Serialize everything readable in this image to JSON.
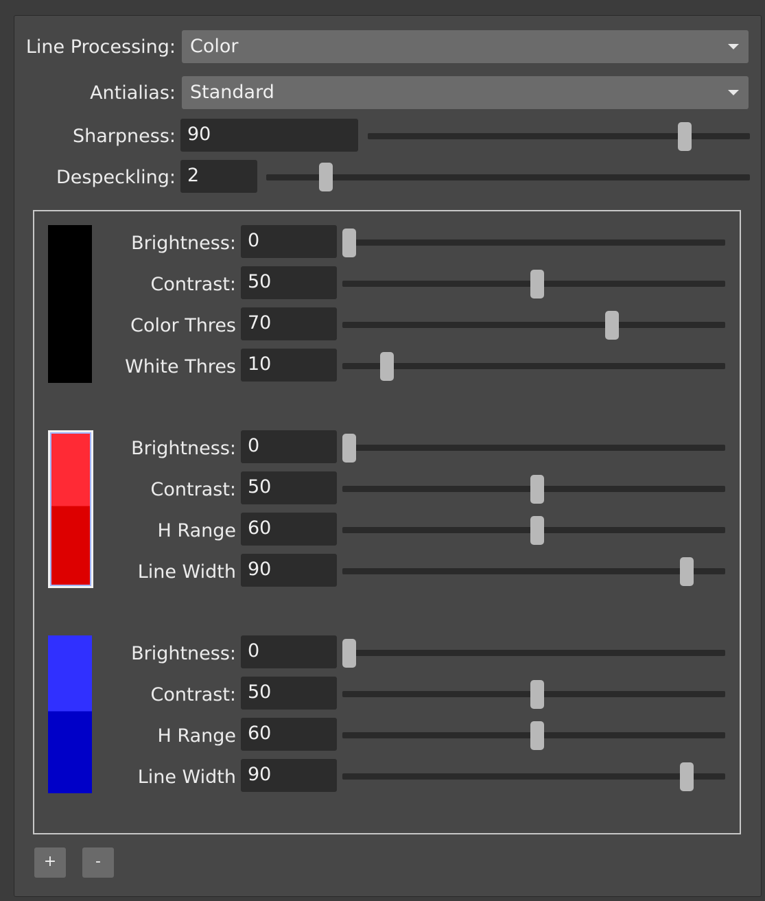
{
  "line_processing": {
    "label": "Line Processing:",
    "value": "Color"
  },
  "antialias": {
    "label": "Antialias:",
    "value": "Standard"
  },
  "sharpness": {
    "label": "Sharpness:",
    "value": "90",
    "level": 0.9
  },
  "despeckling": {
    "label": "Despeckling:",
    "value": "2",
    "level": 0.11
  },
  "groups": [
    {
      "colors": {
        "top": "#000000",
        "bottom": "#000000"
      },
      "rows": [
        {
          "label": "Brightness:",
          "value": "0",
          "level": 0.0
        },
        {
          "label": "Contrast:",
          "value": "50",
          "level": 0.5
        },
        {
          "label": "Color Thres",
          "value": "70",
          "level": 0.7
        },
        {
          "label": "White Thres",
          "value": "10",
          "level": 0.1
        }
      ]
    },
    {
      "colors": {
        "top": "#ff2a35",
        "bottom": "#dd0000"
      },
      "rows": [
        {
          "label": "Brightness:",
          "value": "0",
          "level": 0.0
        },
        {
          "label": "Contrast:",
          "value": "50",
          "level": 0.5
        },
        {
          "label": "H Range",
          "value": "60",
          "level": 0.5
        },
        {
          "label": "Line Width",
          "value": "90",
          "level": 0.9
        }
      ]
    },
    {
      "colors": {
        "top": "#3030ff",
        "bottom": "#0000c8"
      },
      "rows": [
        {
          "label": "Brightness:",
          "value": "0",
          "level": 0.0
        },
        {
          "label": "Contrast:",
          "value": "50",
          "level": 0.5
        },
        {
          "label": "H Range",
          "value": "60",
          "level": 0.5
        },
        {
          "label": "Line Width",
          "value": "90",
          "level": 0.9
        }
      ]
    }
  ],
  "buttons": {
    "add": "+",
    "remove": "-"
  }
}
